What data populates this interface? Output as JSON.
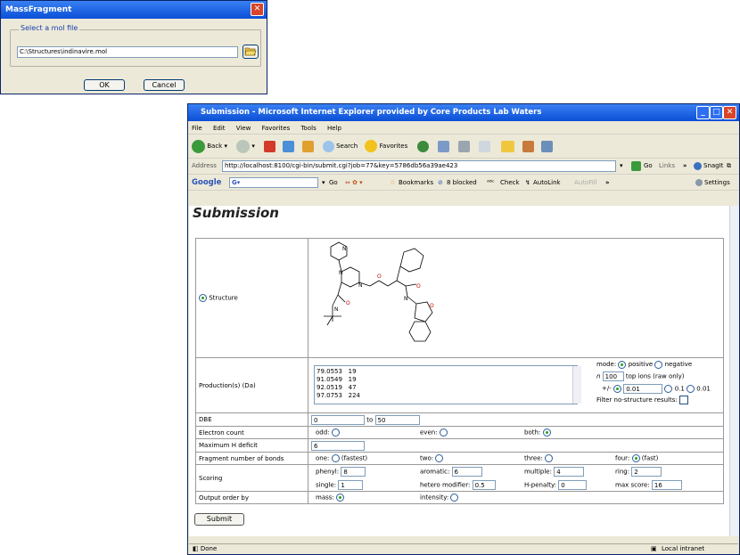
{
  "dialog": {
    "title": "MassFragment",
    "group_label": "Select a mol file",
    "file_value": "C:\\Structures\\indinavire.mol",
    "ok_label": "OK",
    "cancel_label": "Cancel",
    "close_glyph": "✕"
  },
  "browser": {
    "title": "Submission - Microsoft Internet Explorer provided by Core Products Lab Waters",
    "menus": [
      "File",
      "Edit",
      "View",
      "Favorites",
      "Tools",
      "Help"
    ],
    "toolbar": {
      "back": "Back",
      "search": "Search",
      "favorites": "Favorites"
    },
    "address_label": "Address",
    "address": "http://localhost:8100/cgi-bin/submit.cgi?job=77&key=5786db56a39ae423",
    "go": "Go",
    "links": "Links",
    "snagit": "SnagIt",
    "google": {
      "logo": "Google",
      "go": "Go",
      "bookmarks": "Bookmarks",
      "blocked": "8 blocked",
      "check": "Check",
      "autolink": "AutoLink",
      "autofill": "AutoFill",
      "settings": "Settings"
    },
    "status_text": "Done",
    "zone": "Local intranet"
  },
  "form": {
    "heading": "Submission",
    "structure_label": "Structure",
    "product_label": "Production(s) (Da)",
    "product_ions": "79.0553   19\n91.0549   19\n92.0519   47\n97.0753   224",
    "mode_label": "mode:",
    "mode_positive": "positive",
    "mode_negative": "negative",
    "n_label": "n",
    "n_value": "100",
    "top_ions_label": "top ions (raw only)",
    "tol_label": "+/-",
    "tol_value": "0.01",
    "tol_01": "0.1",
    "tol_001": "0.01",
    "filter_label": "Filter no-structure results:",
    "dbe_label": "DBE",
    "dbe_from": "0",
    "dbe_to_label": "to",
    "dbe_to": "50",
    "electron_label": "Electron count",
    "odd": "odd:",
    "even": "even:",
    "both": "both:",
    "hdef_label": "Maximum H deficit",
    "hdef_value": "6",
    "bonds_label": "Fragment number of bonds",
    "one": "one:",
    "one_note": "(fastest)",
    "two": "two:",
    "three": "three:",
    "four": "four:",
    "four_note": "(fast)",
    "scoring_label": "Scoring",
    "phenyl": "phenyl:",
    "phenyl_v": "8",
    "aromatic": "aromatic:",
    "aromatic_v": "6",
    "multiple": "multiple:",
    "multiple_v": "4",
    "ring": "ring:",
    "ring_v": "2",
    "single": "single:",
    "single_v": "1",
    "hetero": "hetero modifier:",
    "hetero_v": "0.5",
    "hpen": "H-penalty:",
    "hpen_v": "0",
    "maxscore": "max score:",
    "maxscore_v": "16",
    "order_label": "Output order by",
    "mass": "mass:",
    "intensity": "intensity:",
    "submit": "Submit"
  }
}
